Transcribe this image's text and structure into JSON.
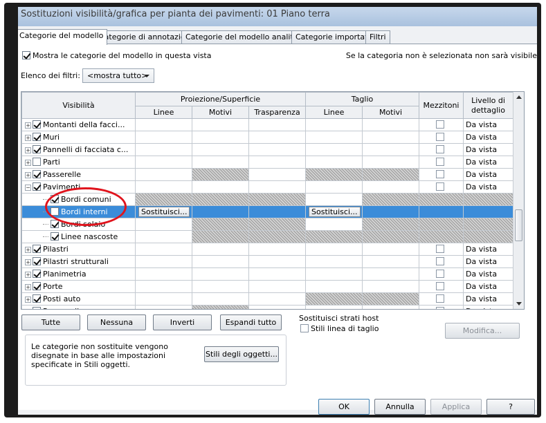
{
  "dialog": {
    "title": "Sostituzioni visibilità/grafica per pianta dei pavimenti: 01 Piano terra"
  },
  "tabs": [
    {
      "label": "Categorie del modello",
      "active": true
    },
    {
      "label": "Categorie di annotazioni",
      "active": false
    },
    {
      "label": "Categorie del modello analitico",
      "active": false
    },
    {
      "label": "Categorie importate",
      "active": false
    },
    {
      "label": "Filtri",
      "active": false
    }
  ],
  "model_tab": {
    "show_categories_label": "Mostra le categorie del modello in questa vista",
    "show_categories_checked": true,
    "unselected_note": "Se la categoria non è selezionata non sarà visibile",
    "filter_list_label": "Elenco dei filtri:",
    "filter_list_value": "<mostra tutto>"
  },
  "grid": {
    "headers": {
      "visibility": "Visibilità",
      "projection_surface": "Proiezione/Superficie",
      "cut": "Taglio",
      "halftone": "Mezzitoni",
      "detail_level": "Livello di dettaglio",
      "lines": "Linee",
      "patterns": "Motivi",
      "transparency": "Trasparenza"
    },
    "override_label": "Sostituisci...",
    "rows": [
      {
        "name": "Montanti della facci...",
        "level": 0,
        "expander": "+",
        "checked": true,
        "halftone": true,
        "detail": "Da vista",
        "hatch": []
      },
      {
        "name": "Muri",
        "level": 0,
        "expander": "+",
        "checked": true,
        "halftone": true,
        "detail": "Da vista",
        "hatch": []
      },
      {
        "name": "Pannelli di facciata c...",
        "level": 0,
        "expander": "+",
        "checked": true,
        "halftone": true,
        "detail": "Da vista",
        "hatch": []
      },
      {
        "name": "Parti",
        "level": 0,
        "expander": "+",
        "checked": false,
        "halftone": true,
        "detail": "Da vista",
        "hatch": []
      },
      {
        "name": "Passerelle",
        "level": 0,
        "expander": "+",
        "checked": true,
        "halftone": true,
        "detail": "Da vista",
        "hatch": [
          "pp",
          "cl",
          "cp"
        ]
      },
      {
        "name": "Pavimenti",
        "level": 0,
        "expander": "-",
        "checked": true,
        "halftone": true,
        "detail": "Da vista",
        "hatch": []
      },
      {
        "name": "Bordi comuni",
        "level": 1,
        "expander": "",
        "checked": true,
        "halftone": false,
        "detail": "",
        "hatch": [
          "pl",
          "pp",
          "pt",
          "cp",
          "ht",
          "dl"
        ]
      },
      {
        "name": "Bordi interni",
        "level": 1,
        "expander": "",
        "checked": false,
        "halftone": false,
        "detail": "",
        "selected": true,
        "hatch": []
      },
      {
        "name": "Bordi solaio",
        "level": 1,
        "expander": "",
        "checked": true,
        "halftone": false,
        "detail": "",
        "hatch": [
          "pp",
          "pt",
          "cp",
          "ht",
          "dl"
        ]
      },
      {
        "name": "Linee nascoste",
        "level": 1,
        "expander": "",
        "checked": true,
        "halftone": false,
        "detail": "",
        "hatch": [
          "pp",
          "pt",
          "cl",
          "cp",
          "ht",
          "dl"
        ]
      },
      {
        "name": "Pilastri",
        "level": 0,
        "expander": "+",
        "checked": true,
        "halftone": true,
        "detail": "Da vista",
        "hatch": []
      },
      {
        "name": "Pilastri strutturali",
        "level": 0,
        "expander": "+",
        "checked": true,
        "halftone": true,
        "detail": "Da vista",
        "hatch": []
      },
      {
        "name": "Planimetria",
        "level": 0,
        "expander": "+",
        "checked": true,
        "halftone": true,
        "detail": "Da vista",
        "hatch": []
      },
      {
        "name": "Porte",
        "level": 0,
        "expander": "+",
        "checked": true,
        "halftone": true,
        "detail": "Da vista",
        "hatch": []
      },
      {
        "name": "Posti auto",
        "level": 0,
        "expander": "+",
        "checked": true,
        "halftone": true,
        "detail": "Da vista",
        "hatch": [
          "cl",
          "cp"
        ]
      },
      {
        "name": "Rampe di accesso",
        "level": 0,
        "expander": "+",
        "checked": true,
        "halftone": true,
        "detail": "Da vista",
        "hatch": [
          "pp"
        ]
      }
    ]
  },
  "buttons": {
    "all": "Tutte",
    "none": "Nessuna",
    "invert": "Inverti",
    "expand_all": "Espandi tutto",
    "object_styles": "Stili degli oggetti...",
    "modify": "Modifica...",
    "ok": "OK",
    "cancel": "Annulla",
    "apply": "Applica",
    "help": "?"
  },
  "host_layers": {
    "title": "Sostituisci strati host",
    "cut_line_styles": "Stili linea di taglio",
    "cut_line_styles_checked": false
  },
  "info": {
    "text": "Le categorie non sostituite vengono disegnate in base alle impostazioni specificate in Stili oggetti."
  },
  "colors": {
    "selection": "#3b8cd9",
    "highlight_ellipse": "#e0141d"
  }
}
